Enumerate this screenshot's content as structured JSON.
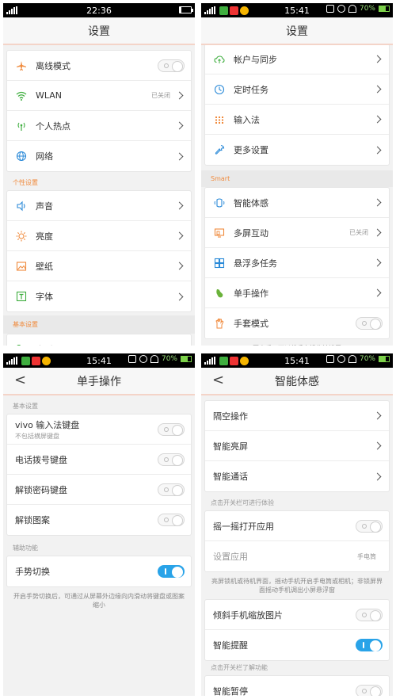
{
  "panel1": {
    "status_time": "22:36",
    "title": "设置",
    "items_top": [
      {
        "label": "离线模式",
        "icon": "airplane-icon",
        "type": "toggle"
      },
      {
        "label": "WLAN",
        "icon": "wifi-icon",
        "status": "已关闭"
      },
      {
        "label": "个人热点",
        "icon": "hotspot-icon"
      },
      {
        "label": "网络",
        "icon": "globe-icon"
      }
    ],
    "section_personal": "个性设置",
    "items_personal": [
      {
        "label": "声音",
        "icon": "speaker-icon"
      },
      {
        "label": "亮度",
        "icon": "brightness-icon"
      },
      {
        "label": "壁纸",
        "icon": "wallpaper-icon"
      },
      {
        "label": "字体",
        "icon": "font-icon"
      }
    ],
    "section_basic": "基本设置",
    "items_basic": [
      {
        "label": "电话",
        "icon": "phone-icon"
      }
    ]
  },
  "panel2": {
    "status_time": "15:41",
    "battery_text": "70%",
    "title": "设置",
    "items_top": [
      {
        "label": "帐户与同步",
        "icon": "cloud-sync-icon"
      },
      {
        "label": "定时任务",
        "icon": "clock-icon"
      },
      {
        "label": "输入法",
        "icon": "keyboard-icon"
      },
      {
        "label": "更多设置",
        "icon": "wrench-icon"
      }
    ],
    "section_smart": "Smart",
    "items_smart": [
      {
        "label": "智能体感",
        "icon": "motion-icon"
      },
      {
        "label": "多屏互动",
        "icon": "multiscreen-icon",
        "status": "已关闭"
      },
      {
        "label": "悬浮多任务",
        "icon": "float-task-icon"
      },
      {
        "label": "单手操作",
        "icon": "one-hand-icon"
      },
      {
        "label": "手套模式",
        "icon": "glove-icon",
        "type": "toggle"
      }
    ],
    "note": "开启后，可以戴手套操作触摸屏"
  },
  "panel3": {
    "status_time": "15:41",
    "battery_text": "70%",
    "back": "<",
    "title": "单手操作",
    "section_basic": "基本设置",
    "items_basic": [
      {
        "label": "vivo 输入法键盘",
        "sub": "不包括横屏键盘",
        "state": "off"
      },
      {
        "label": "电话拨号键盘",
        "state": "off"
      },
      {
        "label": "解锁密码键盘",
        "state": "off"
      },
      {
        "label": "解锁图案",
        "state": "off"
      }
    ],
    "section_assist": "辅助功能",
    "items_assist": [
      {
        "label": "手势切换",
        "state": "on"
      }
    ],
    "note": "开启手势切换后，可通过从屏幕外边缘向内滑动将键盘或图案缩小"
  },
  "panel4": {
    "status_time": "15:41",
    "battery_text": "70%",
    "back": "<",
    "title": "智能体感",
    "items_top": [
      {
        "label": "隔空操作"
      },
      {
        "label": "智能亮屏"
      },
      {
        "label": "智能通话"
      }
    ],
    "section_try": "点击开关栏可进行体验",
    "items_shake": [
      {
        "label": "摇一摇打开应用",
        "state": "off"
      },
      {
        "label": "设置应用",
        "value": "手电筒"
      }
    ],
    "note_shake": "亮屏锁机或待机界面，摇动手机开启手电筒或相机；非锁屏界面摇动手机调出小屏悬浮窗",
    "items_more": [
      {
        "label": "倾斜手机缩放图片",
        "state": "off"
      },
      {
        "label": "智能提醒",
        "state": "on"
      }
    ],
    "section_learn": "点击开关栏了解功能",
    "items_learn": [
      {
        "label": "智能暂停",
        "state": "off"
      }
    ]
  },
  "colors": {
    "accent_orange": "#f08a3c",
    "toggle_on": "#29a3e8",
    "icon_green": "#3fae3f"
  }
}
